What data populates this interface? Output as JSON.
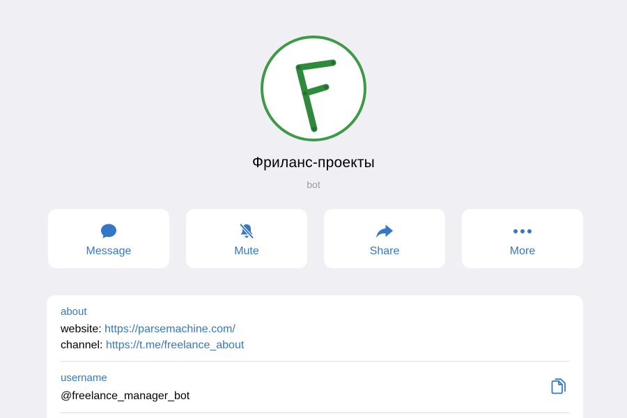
{
  "profile": {
    "name": "Фриланс-проекты",
    "type": "bot",
    "avatar_icon": "letter-f-logo"
  },
  "actions": [
    {
      "label": "Message",
      "icon": "chat-bubble-icon"
    },
    {
      "label": "Mute",
      "icon": "bell-slash-icon"
    },
    {
      "label": "Share",
      "icon": "share-arrow-icon"
    },
    {
      "label": "More",
      "icon": "ellipsis-icon"
    }
  ],
  "about": {
    "label": "about",
    "website_prefix": "website: ",
    "website_url": "https://parsemachine.com/",
    "channel_prefix": "channel: ",
    "channel_url": "https://t.me/freelance_about"
  },
  "username": {
    "label": "username",
    "value": "@freelance_manager_bot",
    "copy_icon": "copy-icon"
  },
  "colors": {
    "background": "#efeff4",
    "accent": "#3478c5",
    "avatar_green": "#3f9a48",
    "secondary_text": "#9a9aa0"
  }
}
